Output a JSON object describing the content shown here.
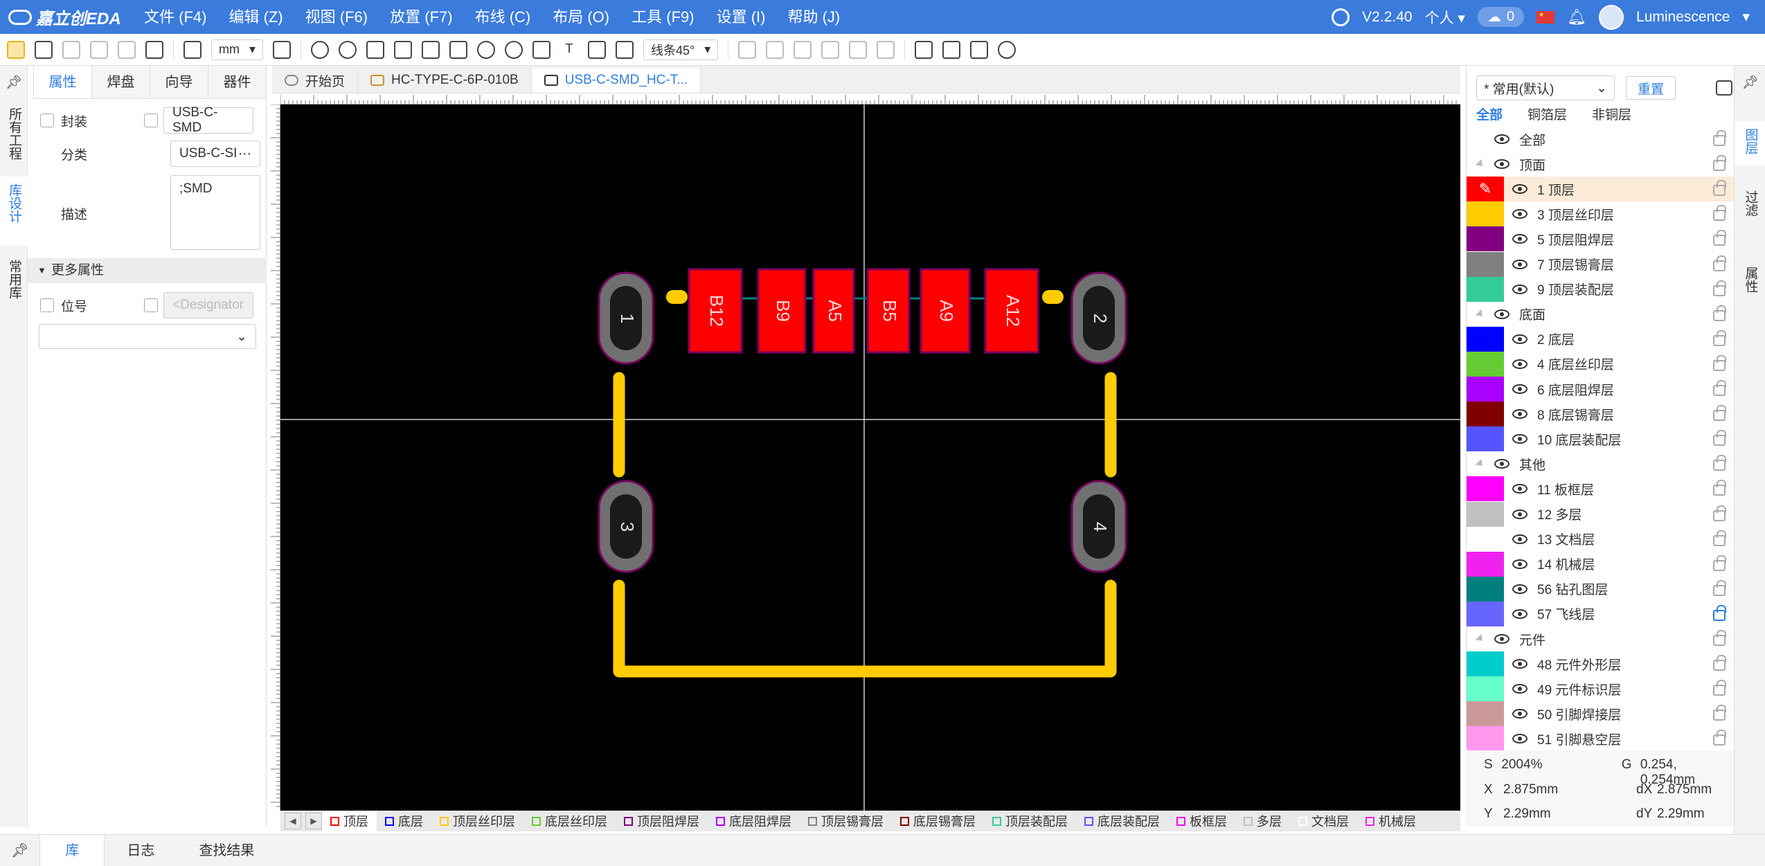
{
  "app": {
    "logo_text": "嘉立创EDA",
    "version": "V2.2.40",
    "workspace": "个人",
    "cloud_count": "0",
    "username": "Luminescence"
  },
  "menu": [
    "文件 (F4)",
    "编辑 (Z)",
    "视图 (F6)",
    "放置 (F7)",
    "布线 (C)",
    "布局 (O)",
    "工具 (F9)",
    "设置 (I)",
    "帮助 (J)"
  ],
  "toolbar": {
    "unit": "mm",
    "line_mode": "线条45°"
  },
  "left_strip": [
    "所有工程",
    "库设计",
    "常用库"
  ],
  "props": {
    "tabs": [
      "属性",
      "焊盘",
      "向导",
      "器件"
    ],
    "footprint_label": "封装",
    "footprint_value": "USB-C-SMD",
    "category_label": "分类",
    "category_value": "USB-C-SI",
    "desc_label": "描述",
    "desc_value": ";SMD",
    "more_props": "更多属性",
    "designator_label": "位号",
    "designator_placeholder": "<Designator"
  },
  "doc_tabs": [
    "开始页",
    "HC-TYPE-C-6P-010B",
    "USB-C-SMD_HC-T..."
  ],
  "canvas": {
    "pads": [
      "B12",
      "B9",
      "A5",
      "B5",
      "A9",
      "A12"
    ],
    "holes": [
      "1",
      "2",
      "3",
      "4"
    ]
  },
  "layer_bar": [
    {
      "label": "顶层",
      "color": "#ff0000"
    },
    {
      "label": "底层",
      "color": "#0000ff"
    },
    {
      "label": "顶层丝印层",
      "color": "#ffcc00"
    },
    {
      "label": "底层丝印层",
      "color": "#66cc33"
    },
    {
      "label": "顶层阻焊层",
      "color": "#800080"
    },
    {
      "label": "底层阻焊层",
      "color": "#aa00ff"
    },
    {
      "label": "顶层锡膏层",
      "color": "#808080"
    },
    {
      "label": "底层锡膏层",
      "color": "#800000"
    },
    {
      "label": "顶层装配层",
      "color": "#33cc99"
    },
    {
      "label": "底层装配层",
      "color": "#5555ff"
    },
    {
      "label": "板框层",
      "color": "#ff00ff"
    },
    {
      "label": "多层",
      "color": "#c0c0c0"
    },
    {
      "label": "文档层",
      "color": "#ffffff"
    },
    {
      "label": "机械层",
      "color": "#f022f0"
    }
  ],
  "bottom_tabs": [
    "库",
    "日志",
    "查找结果"
  ],
  "layers_panel": {
    "preset": "* 常用(默认)",
    "reset": "重置",
    "filters": [
      "全部",
      "铜箔层",
      "非铜层"
    ],
    "groups": {
      "all": "全部",
      "top": "顶面",
      "bottom": "底面",
      "other": "其他",
      "component": "元件"
    },
    "rows": [
      {
        "name": "1 顶层",
        "color": "#ff0000"
      },
      {
        "name": "3 顶层丝印层",
        "color": "#ffcc00"
      },
      {
        "name": "5 顶层阻焊层",
        "color": "#800080"
      },
      {
        "name": "7 顶层锡膏层",
        "color": "#808080"
      },
      {
        "name": "9 顶层装配层",
        "color": "#33cc99"
      },
      {
        "name": "2 底层",
        "color": "#0000ff"
      },
      {
        "name": "4 底层丝印层",
        "color": "#66cc33"
      },
      {
        "name": "6 底层阻焊层",
        "color": "#aa00ff"
      },
      {
        "name": "8 底层锡膏层",
        "color": "#800000"
      },
      {
        "name": "10 底层装配层",
        "color": "#5555ff"
      },
      {
        "name": "11 板框层",
        "color": "#ff00ff"
      },
      {
        "name": "12 多层",
        "color": "#c0c0c0"
      },
      {
        "name": "13 文档层",
        "color": "#ffffff"
      },
      {
        "name": "14 机械层",
        "color": "#f022f0"
      },
      {
        "name": "56 钻孔图层",
        "color": "#007f7f"
      },
      {
        "name": "57 飞线层",
        "color": "#6666ff"
      },
      {
        "name": "48 元件外形层",
        "color": "#00cccc"
      },
      {
        "name": "49 元件标识层",
        "color": "#66ffcc"
      },
      {
        "name": "50 引脚焊接层",
        "color": "#cc9999"
      },
      {
        "name": "51 引脚悬空层",
        "color": "#ff99ee"
      }
    ]
  },
  "right_strip": [
    "图层",
    "过滤",
    "属性"
  ],
  "status": {
    "s_label": "S",
    "s_value": "2004%",
    "g_label": "G",
    "g_value": "0.254, 0.254mm",
    "x_label": "X",
    "x_value": "2.875mm",
    "dx_label": "dX",
    "dx_value": "2.875mm",
    "y_label": "Y",
    "y_value": "2.29mm",
    "dy_label": "dY",
    "dy_value": "2.29mm"
  }
}
